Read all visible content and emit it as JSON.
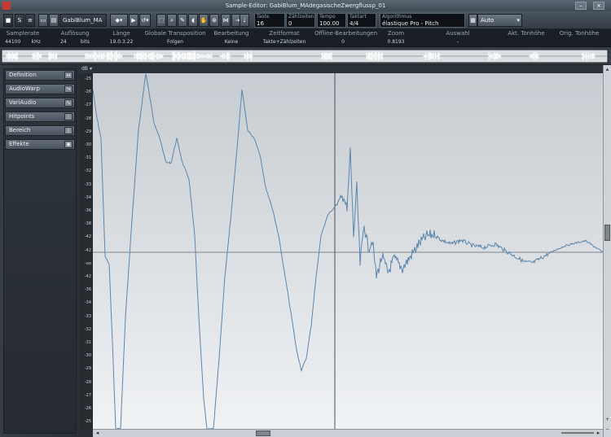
{
  "window": {
    "title": "Sample-Editor: GabiBlum_MAdegasischeZwergflussp_01"
  },
  "toolbar": {
    "track_name": "GabiBlum_MA",
    "fields": [
      {
        "label": "Taste",
        "value": "16"
      },
      {
        "label": "Zählzeiten",
        "value": "0"
      },
      {
        "label": "Tempo",
        "value": "100.00"
      },
      {
        "label": "Taktart",
        "value": "4/4"
      },
      {
        "label": "Algorithmus",
        "value": "élastique Pro - Pitch"
      }
    ],
    "auto_label": "Auto"
  },
  "info": [
    {
      "header": "Samplerate",
      "value": "44100",
      "unit": "kHz"
    },
    {
      "header": "Auflösung",
      "value": "24",
      "unit": "bits"
    },
    {
      "header": "Länge",
      "value": "19.0.3.22"
    },
    {
      "header": "Globale Transposition",
      "value": "Folgen"
    },
    {
      "header": "Bearbeitung",
      "value": "Keine"
    },
    {
      "header": "Zeitformat",
      "value": "Takte+Zählzeiten"
    },
    {
      "header": "Offline-Bearbeitungen",
      "value": "0"
    },
    {
      "header": "Zoom",
      "value": "0.8193"
    },
    {
      "header": "Auswahl",
      "value": "-"
    },
    {
      "header": "Akt. Tonhöhe",
      "value": ""
    },
    {
      "header": "Orig. Tonhöhe",
      "value": ""
    }
  ],
  "ruler": {
    "unit": "dB"
  },
  "sections": [
    "Definition",
    "AudioWarp",
    "VariAudio",
    "Hitpoints",
    "Bereich",
    "Effekte"
  ],
  "dB_labels": [
    "-25",
    "-26",
    "-27",
    "-28",
    "-29",
    "-30",
    "-31",
    "-32",
    "-33",
    "-34",
    "-36",
    "-38",
    "-42",
    "-42",
    "-oo",
    "-42",
    "-36",
    "-34",
    "-33",
    "-32",
    "-31",
    "-30",
    "-29",
    "-28",
    "-27",
    "-26",
    "-25"
  ],
  "colors": {
    "waveform": "#5b86ac",
    "cursor": "#4a4f55"
  }
}
